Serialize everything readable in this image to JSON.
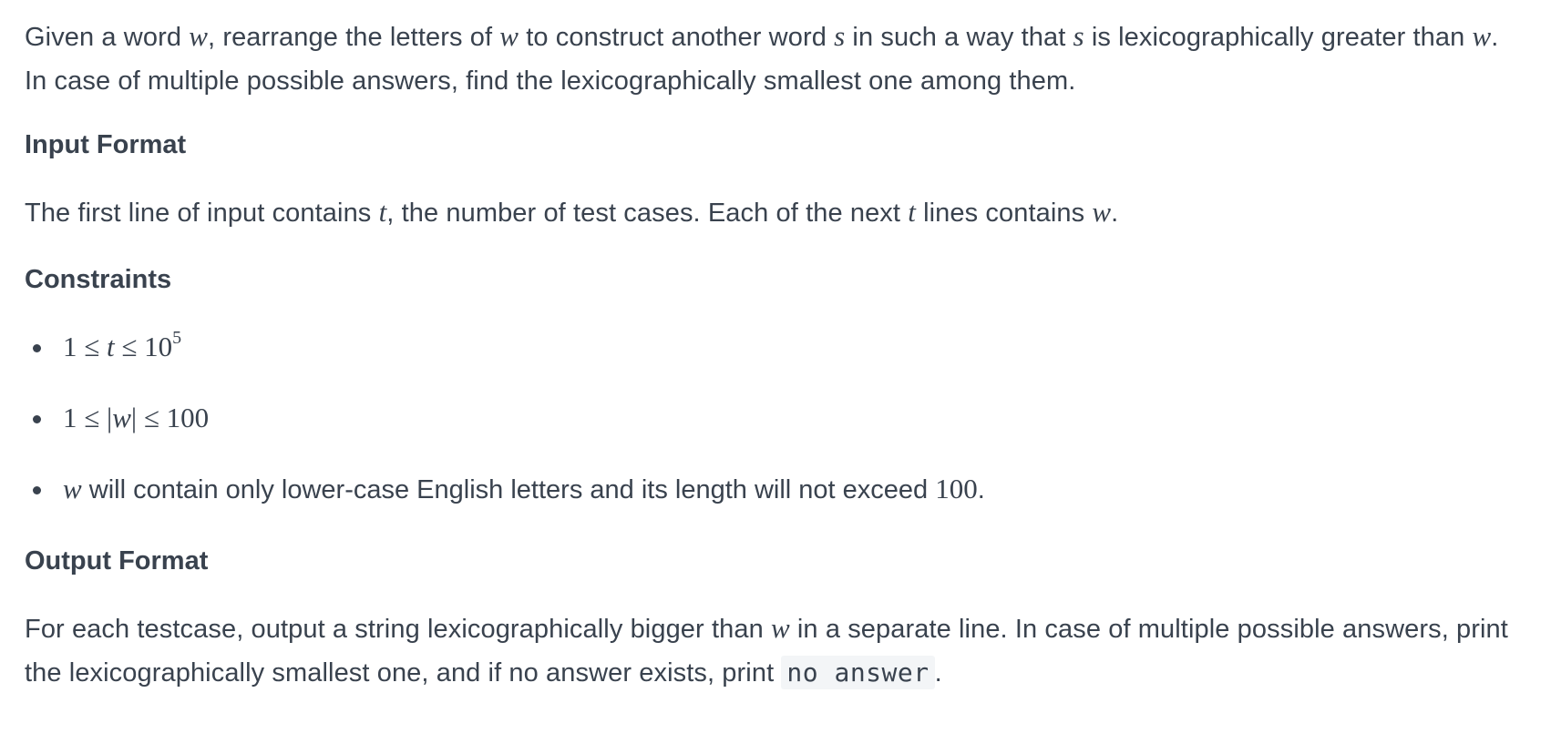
{
  "intro": {
    "t1": "Given a word ",
    "v1": "w",
    "t2": ", rearrange the letters of ",
    "v2": "w",
    "t3": " to construct another word ",
    "v3": "s",
    "t4": " in such a way that ",
    "v4": "s",
    "t5": " is lexicographically greater than ",
    "v5": "w",
    "t6": ". In case of multiple possible answers, find the lexicographically smallest one among them."
  },
  "input_format": {
    "heading": "Input Format",
    "t1": "The first line of input contains ",
    "v1": "t",
    "t2": ", the number of test cases. Each of the next ",
    "v2": "t",
    "t3": " lines contains ",
    "v3": "w",
    "t4": "."
  },
  "constraints": {
    "heading": "Constraints",
    "c1": {
      "a": "1",
      "op1": " ≤ ",
      "v": "t",
      "op2": " ≤ ",
      "base": "10",
      "exp": "5"
    },
    "c2": {
      "a": "1",
      "op1": " ≤ ",
      "bar1": "|",
      "v": "w",
      "bar2": "|",
      "op2": " ≤ ",
      "b": "100"
    },
    "c3": {
      "v": "w",
      "t1": " will contain only lower-case English letters and its length will not exceed ",
      "n": "100",
      "t2": "."
    }
  },
  "output_format": {
    "heading": "Output Format",
    "t1": "For each testcase, output a string lexicographically bigger than ",
    "v1": "w",
    "t2": " in a separate line. In case of multiple possible answers, print the lexicographically smallest one, and if no answer exists, print ",
    "code": "no answer",
    "t3": "."
  }
}
